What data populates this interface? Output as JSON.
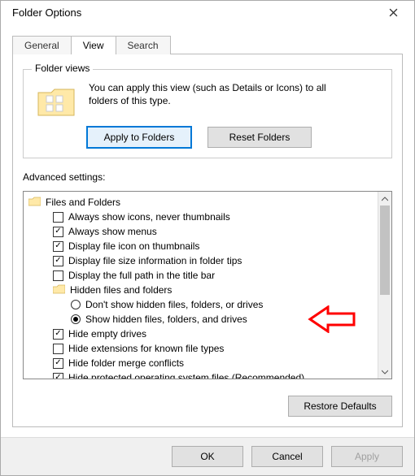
{
  "window": {
    "title": "Folder Options"
  },
  "tabs": {
    "general": "General",
    "view": "View",
    "search": "Search",
    "active": "view"
  },
  "folder_views": {
    "legend": "Folder views",
    "desc": "You can apply this view (such as Details or Icons) to all folders of this type.",
    "apply_btn": "Apply to Folders",
    "reset_btn": "Reset Folders"
  },
  "advanced": {
    "label": "Advanced settings:",
    "root_label": "Files and Folders",
    "items": [
      {
        "type": "check",
        "checked": false,
        "label": "Always show icons, never thumbnails"
      },
      {
        "type": "check",
        "checked": true,
        "label": "Always show menus"
      },
      {
        "type": "check",
        "checked": true,
        "label": "Display file icon on thumbnails"
      },
      {
        "type": "check",
        "checked": true,
        "label": "Display file size information in folder tips"
      },
      {
        "type": "check",
        "checked": false,
        "label": "Display the full path in the title bar"
      },
      {
        "type": "folder",
        "label": "Hidden files and folders"
      },
      {
        "type": "radio",
        "selected": false,
        "label": "Don't show hidden files, folders, or drives"
      },
      {
        "type": "radio",
        "selected": true,
        "label": "Show hidden files, folders, and drives"
      },
      {
        "type": "check",
        "checked": true,
        "label": "Hide empty drives"
      },
      {
        "type": "check",
        "checked": false,
        "label": "Hide extensions for known file types"
      },
      {
        "type": "check",
        "checked": true,
        "label": "Hide folder merge conflicts"
      },
      {
        "type": "check",
        "checked": true,
        "label": "Hide protected operating system files (Recommended)"
      }
    ]
  },
  "buttons": {
    "restore_defaults": "Restore Defaults",
    "ok": "OK",
    "cancel": "Cancel",
    "apply": "Apply"
  }
}
